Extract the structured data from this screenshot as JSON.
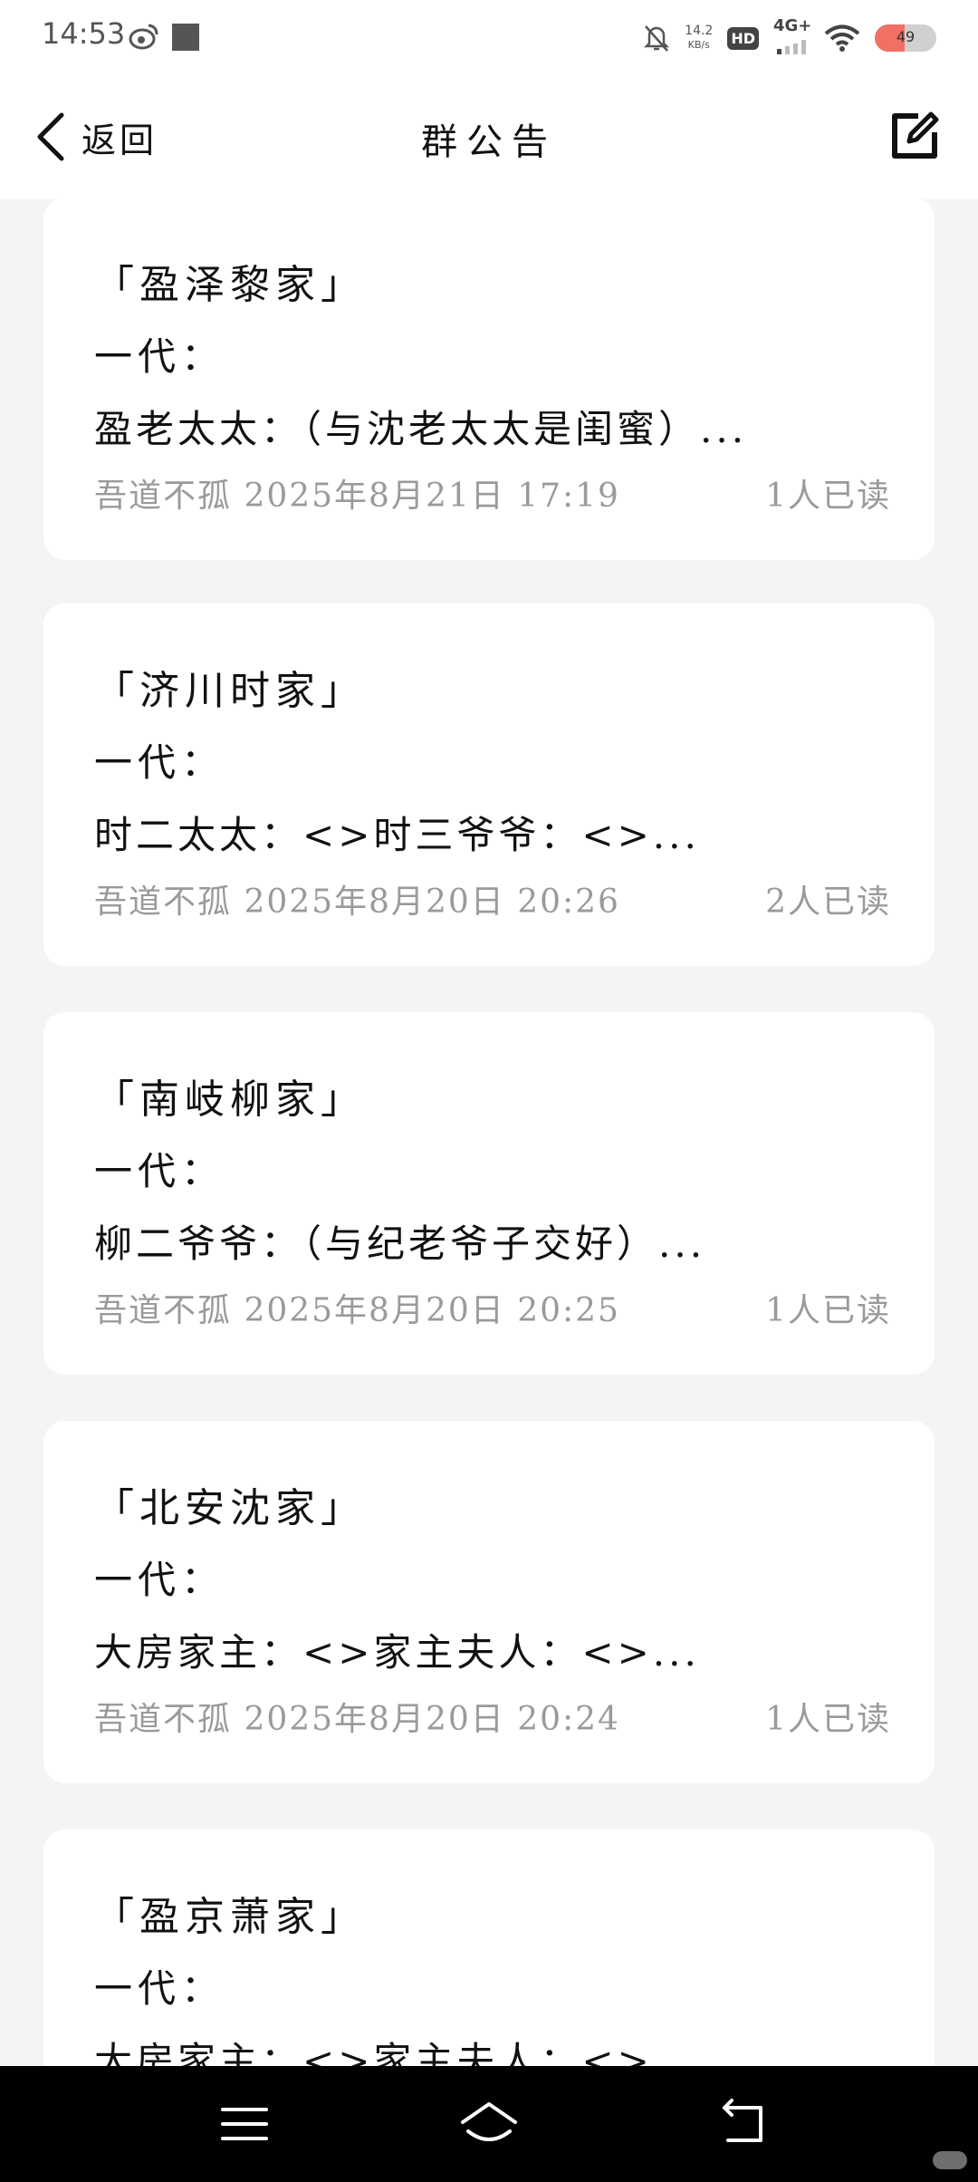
{
  "status_bar": {
    "time": "14:53",
    "net_speed_value": "14.2",
    "net_speed_unit": "KB/s",
    "hd_label": "HD",
    "network_label": "4G+",
    "battery_level": "49",
    "battery_fraction": 0.49,
    "battery_color": "#f07064"
  },
  "header": {
    "back_label": "返回",
    "title": "群公告",
    "edit_icon": "edit-icon"
  },
  "announcements": [
    {
      "title": "「盈泽黎家」",
      "line2": "一代：",
      "preview": "盈老太太：（与沈老太太是闺蜜）...",
      "meta": "吾道不孤 2025年8月21日 17:19",
      "read": "1人已读"
    },
    {
      "title": "「济川时家」",
      "line2": "一代：",
      "preview": "时二太太：<>时三爷爷：<>...",
      "meta": "吾道不孤 2025年8月20日 20:26",
      "read": "2人已读"
    },
    {
      "title": "「南岐柳家」",
      "line2": "一代：",
      "preview": "柳二爷爷：（与纪老爷子交好）...",
      "meta": "吾道不孤 2025年8月20日 20:25",
      "read": "1人已读"
    },
    {
      "title": "「北安沈家」",
      "line2": "一代：",
      "preview": "大房家主：<>家主夫人：<>...",
      "meta": "吾道不孤 2025年8月20日 20:24",
      "read": "1人已读"
    },
    {
      "title": "「盈京萧家」",
      "line2": "一代：",
      "preview": "大房家主：<>家主夫人：<>...",
      "meta": "",
      "read": ""
    }
  ],
  "nav_bar": {
    "menu_icon": "menu-icon",
    "home_icon": "home-icon",
    "back_icon": "back-arrow-icon"
  }
}
